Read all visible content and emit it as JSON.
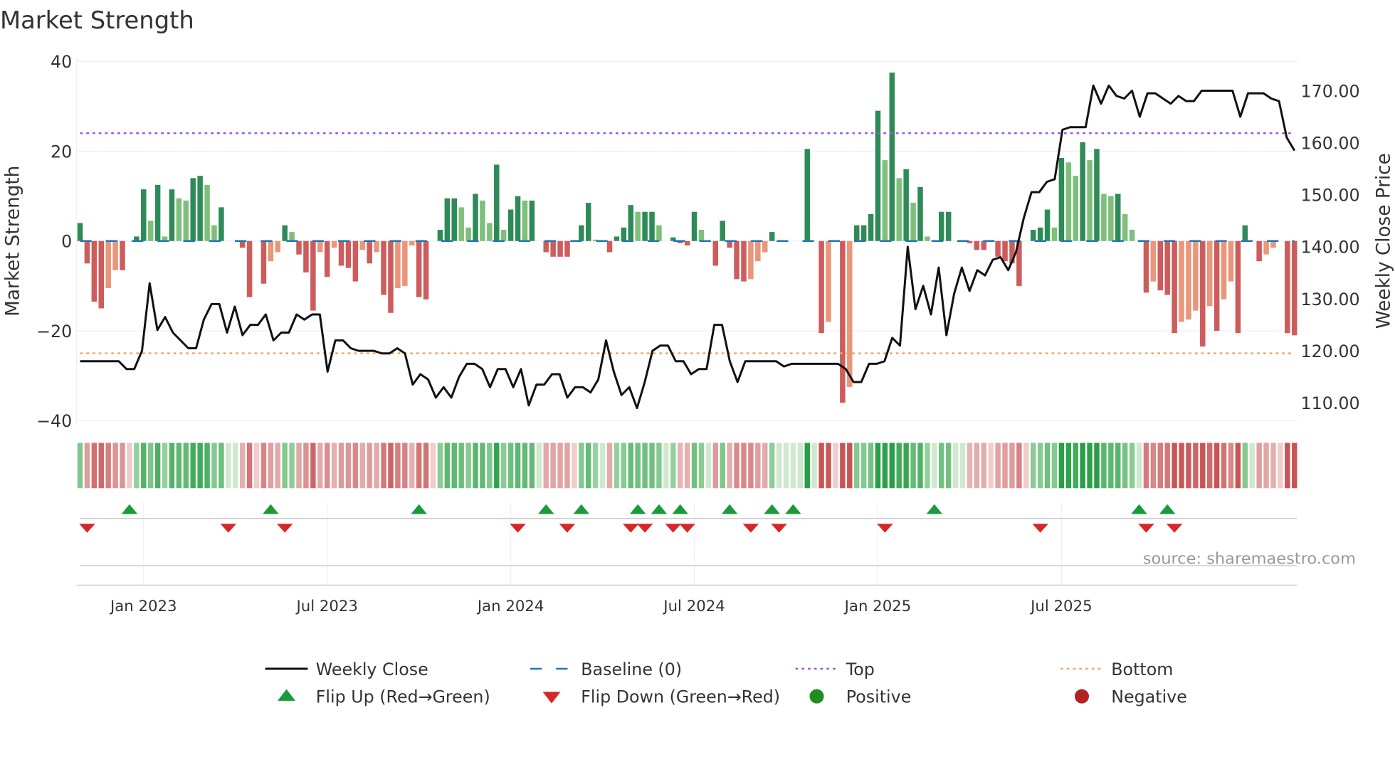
{
  "chart_data": {
    "type": "bar",
    "title": "Market Strength",
    "ylabel": "Market Strength",
    "y2label": "Weekly Close Price",
    "ylim": [
      -40,
      40
    ],
    "y2lim": [
      106.5,
      174.5
    ],
    "yticks": [
      40,
      20,
      0,
      -20,
      -40
    ],
    "ytick_labels": [
      "40",
      "20",
      "0",
      "−20",
      "−40"
    ],
    "y2ticks": [
      170,
      160,
      150,
      140,
      130,
      120,
      110
    ],
    "y2tick_labels": [
      "170.00",
      "160.00",
      "150.00",
      "140.00",
      "130.00",
      "120.00",
      "110.00"
    ],
    "xticks": [
      {
        "week": 9,
        "label": "Jan 2023"
      },
      {
        "week": 35,
        "label": "Jul 2023"
      },
      {
        "week": 61,
        "label": "Jan 2024"
      },
      {
        "week": 87,
        "label": "Jul 2024"
      },
      {
        "week": 113,
        "label": "Jan 2025"
      },
      {
        "week": 139,
        "label": "Jul 2025"
      }
    ],
    "top_level": 24,
    "bottom_level": -25,
    "strength": [
      4,
      -5,
      -13.5,
      -15,
      -10.5,
      -6.5,
      -6.5,
      0,
      1,
      11.5,
      4.5,
      12.5,
      1,
      11.5,
      9.5,
      9,
      14,
      14.5,
      12.5,
      3.5,
      7.5,
      0,
      0,
      -1.5,
      -12.5,
      0,
      -9.5,
      -4.5,
      -2.5,
      3.5,
      2,
      -3,
      -7,
      -15.5,
      -2.5,
      -8,
      -1.5,
      -5.5,
      -6,
      -9,
      -2,
      -5,
      -2.5,
      -12,
      -16,
      -10.5,
      -10,
      -1,
      -12.5,
      -13,
      0,
      2.5,
      9.5,
      9.5,
      7.5,
      3,
      10.5,
      9,
      4,
      17,
      2.5,
      7,
      10,
      9,
      9,
      0,
      -2.5,
      -3.5,
      -3.5,
      -3.5,
      0,
      3.5,
      8.5,
      0.3,
      0,
      -2.5,
      1,
      3,
      8,
      6.5,
      6.5,
      6.5,
      3.5,
      0,
      0.8,
      -0.5,
      -1,
      6.5,
      2.5,
      0,
      -5.5,
      4.5,
      -1.5,
      -8.5,
      -9,
      -8.5,
      -4.5,
      -2.5,
      2,
      0,
      0,
      0,
      0,
      20.5,
      0,
      -20.5,
      -18,
      0,
      -36,
      -32.5,
      3.5,
      3.5,
      6,
      29,
      18,
      37.5,
      14,
      16,
      8.5,
      12,
      1,
      0,
      6.5,
      6.5,
      0,
      0,
      -0.5,
      -2,
      -2,
      0,
      -3.5,
      -4.5,
      -5,
      -10,
      0,
      2.5,
      3,
      7,
      3,
      18.5,
      17.5,
      14.5,
      22,
      18,
      20.5,
      10.5,
      10,
      10.5,
      6,
      2.5,
      0,
      -11.5,
      -9,
      -11,
      -12,
      -20.5,
      -18,
      -17.5,
      -15.5,
      -23.5,
      -14.5,
      -20,
      -13,
      -9,
      -20.5,
      3.5,
      0,
      -4.5,
      -3,
      -1.5,
      0,
      -20.5,
      -21
    ],
    "weekly_close": [
      118,
      118,
      118,
      118,
      118,
      118,
      116.5,
      116.5,
      120,
      133,
      124,
      126.5,
      123.5,
      122,
      120.5,
      120.5,
      126,
      129,
      129,
      123.5,
      128.5,
      123,
      125,
      125,
      127,
      122,
      123.5,
      123.5,
      127,
      126,
      127,
      127,
      116,
      122,
      122,
      120.5,
      120,
      120,
      120,
      119.5,
      119.5,
      120.5,
      119.5,
      113.5,
      115.5,
      114.5,
      111,
      113,
      111,
      115,
      117.5,
      117.5,
      116.5,
      113,
      116.5,
      116.5,
      113,
      116.5,
      109.5,
      113.5,
      113.5,
      115.5,
      115.5,
      111,
      113,
      113,
      112,
      114.5,
      122,
      116,
      111.5,
      113,
      109,
      114,
      120,
      121,
      121,
      118,
      118,
      115.5,
      116.5,
      116.5,
      125,
      125,
      118,
      114,
      118,
      118,
      118,
      118,
      118,
      117,
      117.5,
      117.5,
      117.5,
      117.5,
      117.5,
      117.5,
      117.5,
      116.5,
      114,
      114,
      117.5,
      117.5,
      118,
      122.5,
      121,
      140,
      128,
      132.5,
      127,
      136,
      123,
      131,
      136,
      131.5,
      135.5,
      134.5,
      137.5,
      138,
      135.5,
      139,
      145.5,
      150.5,
      150.5,
      152.5,
      153,
      162.5,
      163,
      163,
      163,
      171,
      167.5,
      171,
      169,
      168.5,
      170,
      165,
      169.5,
      169.5,
      168.5,
      167.5,
      169,
      168,
      168,
      170,
      170,
      170,
      170,
      170,
      165,
      169.5,
      169.5,
      169.5,
      168.5,
      168,
      161,
      158.5
    ],
    "flip_up_weeks": [
      7,
      27,
      48,
      66,
      71,
      79,
      82,
      85,
      92,
      98,
      101,
      121,
      150,
      154
    ],
    "flip_down_weeks": [
      1,
      21,
      29,
      62,
      69,
      78,
      80,
      84,
      86,
      95,
      99,
      114,
      136,
      151,
      155
    ],
    "colors": {
      "dark_green": "#2e8b57",
      "light_green": "#7fbf7b",
      "dark_red": "#cd5c5c",
      "light_red": "#e9967a",
      "top": "#9b59d6",
      "bottom": "#f4a460",
      "baseline": "#1f77b4",
      "flip_up": "#1a9a3a",
      "flip_down": "#d62728"
    },
    "legend": {
      "position": "bottom",
      "items": [
        {
          "label": "Weekly Close",
          "kind": "line"
        },
        {
          "label": "Baseline (0)",
          "kind": "dash"
        },
        {
          "label": "Top",
          "kind": "dot-purple"
        },
        {
          "label": "Bottom",
          "kind": "dot-orange"
        },
        {
          "label": "Flip Up (Red→Green)",
          "kind": "up"
        },
        {
          "label": "Flip Down (Green→Red)",
          "kind": "down"
        },
        {
          "label": "Positive",
          "kind": "pos"
        },
        {
          "label": "Negative",
          "kind": "neg"
        }
      ]
    },
    "source": "source: sharemaestro.com"
  }
}
